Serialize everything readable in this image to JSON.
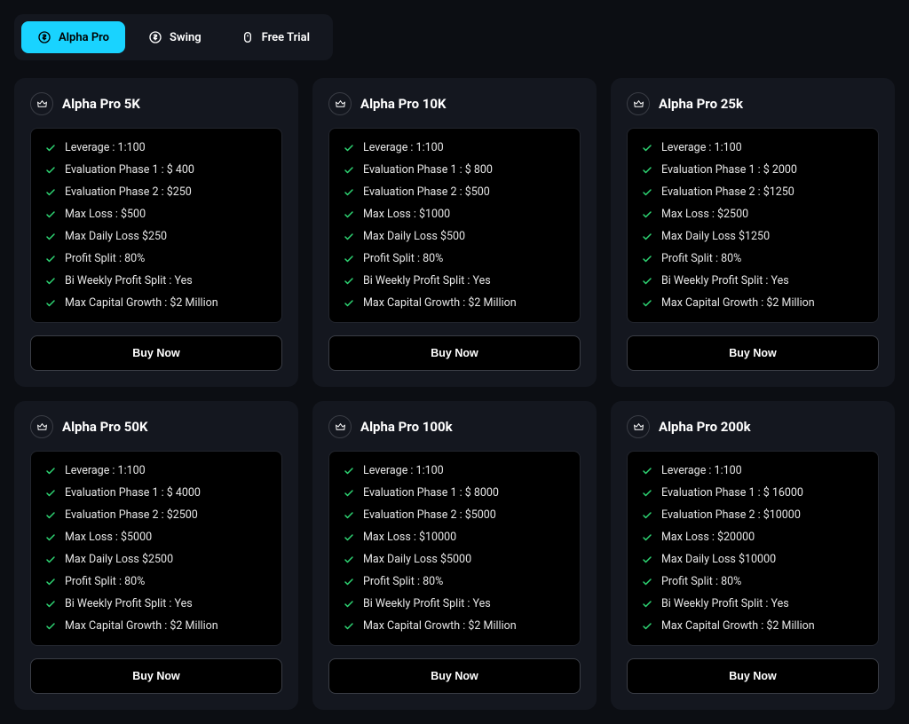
{
  "tabs": [
    {
      "label": "Alpha Pro",
      "active": true,
      "icon": "dollar"
    },
    {
      "label": "Swing",
      "active": false,
      "icon": "dollar-outline"
    },
    {
      "label": "Free Trial",
      "active": false,
      "icon": "mouse"
    }
  ],
  "buy_label": "Buy Now",
  "plans": [
    {
      "title": "Alpha Pro 5K",
      "features": [
        "Leverage : 1:100",
        "Evaluation Phase 1 : $ 400",
        "Evaluation Phase 2 : $250",
        "Max Loss : $500",
        "Max Daily Loss $250",
        "Profit Split : 80%",
        "Bi Weekly Profit Split : Yes",
        "Max Capital Growth : $2 Million"
      ]
    },
    {
      "title": "Alpha Pro 10K",
      "features": [
        "Leverage : 1:100",
        "Evaluation Phase 1 : $ 800",
        "Evaluation Phase 2 : $500",
        "Max Loss : $1000",
        "Max Daily Loss $500",
        "Profit Split : 80%",
        "Bi Weekly Profit Split : Yes",
        "Max Capital Growth : $2 Million"
      ]
    },
    {
      "title": "Alpha Pro 25k",
      "features": [
        "Leverage : 1:100",
        "Evaluation Phase 1 : $ 2000",
        "Evaluation Phase 2 : $1250",
        "Max Loss : $2500",
        "Max Daily Loss $1250",
        "Profit Split : 80%",
        "Bi Weekly Profit Split : Yes",
        "Max Capital Growth : $2 Million"
      ]
    },
    {
      "title": "Alpha Pro 50K",
      "features": [
        "Leverage : 1:100",
        "Evaluation Phase 1 : $ 4000",
        "Evaluation Phase 2 : $2500",
        "Max Loss : $5000",
        "Max Daily Loss $2500",
        "Profit Split : 80%",
        "Bi Weekly Profit Split : Yes",
        "Max Capital Growth : $2 Million"
      ]
    },
    {
      "title": "Alpha Pro 100k",
      "features": [
        "Leverage : 1:100",
        "Evaluation Phase 1 : $ 8000",
        "Evaluation Phase 2 : $5000",
        "Max Loss : $10000",
        "Max Daily Loss $5000",
        "Profit Split : 80%",
        "Bi Weekly Profit Split : Yes",
        "Max Capital Growth : $2 Million"
      ]
    },
    {
      "title": "Alpha Pro 200k",
      "features": [
        "Leverage : 1:100",
        "Evaluation Phase 1 : $ 16000",
        "Evaluation Phase 2 : $10000",
        "Max Loss : $20000",
        "Max Daily Loss $10000",
        "Profit Split : 80%",
        "Bi Weekly Profit Split : Yes",
        "Max Capital Growth : $2 Million"
      ]
    }
  ]
}
